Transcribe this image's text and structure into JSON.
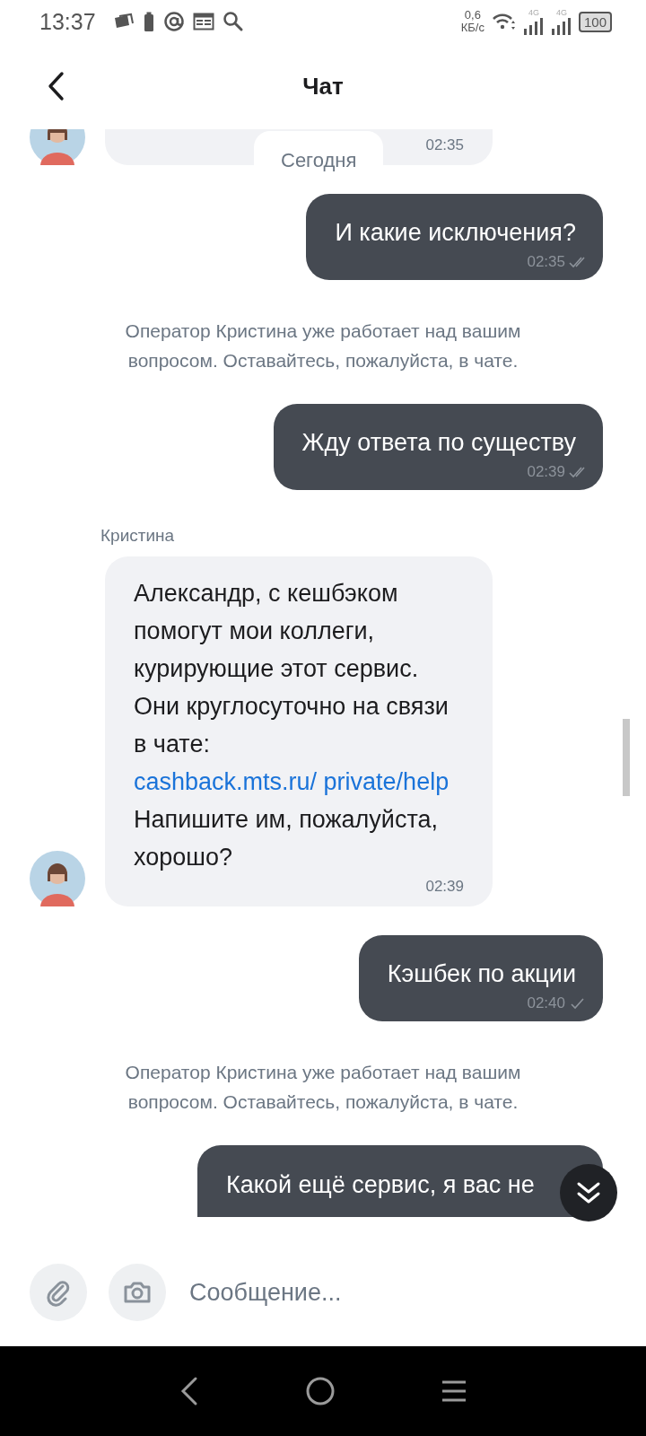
{
  "status_bar": {
    "time": "13:37",
    "net_speed": "0,6",
    "net_unit": "КБ/с",
    "sim_labels": [
      "4G",
      "4G"
    ],
    "battery": "100"
  },
  "header": {
    "title": "Чат"
  },
  "messages": [
    {
      "kind": "incoming",
      "avatar": true,
      "cut": true,
      "time": "02:35"
    },
    {
      "kind": "date",
      "text": "Сегодня"
    },
    {
      "kind": "outgoing",
      "text": "И какие исключения?",
      "time": "02:35",
      "read": true
    },
    {
      "kind": "system",
      "text": "Оператор Кристина уже работает над вашим вопросом. Оставайтесь, пожалуйста, в чате."
    },
    {
      "kind": "outgoing",
      "text": "Жду ответа по существу",
      "time": "02:39",
      "read": true
    },
    {
      "kind": "sender",
      "text": "Кристина"
    },
    {
      "kind": "incoming",
      "avatar": true,
      "time": "02:39",
      "parts": [
        {
          "kind": "text",
          "text": "Александр, с кешбэком помогут мои коллеги, курирующие этот сервис. Они круглосуточно на связи в чате: "
        },
        {
          "kind": "link",
          "text": "cashback.mts.ru/ private/help"
        },
        {
          "kind": "text",
          "text": " Напишите им, пожалуйста, хорошо?"
        }
      ]
    },
    {
      "kind": "outgoing",
      "text": "Кэшбек по акции",
      "time": "02:40",
      "read": false
    },
    {
      "kind": "system",
      "text": "Оператор Кристина уже работает над вашим вопросом. Оставайтесь, пожалуйста, в чате."
    },
    {
      "kind": "outgoing",
      "text": "Какой ещё сервис, я вас не",
      "cut": true
    }
  ],
  "composer": {
    "placeholder": "Сообщение..."
  }
}
